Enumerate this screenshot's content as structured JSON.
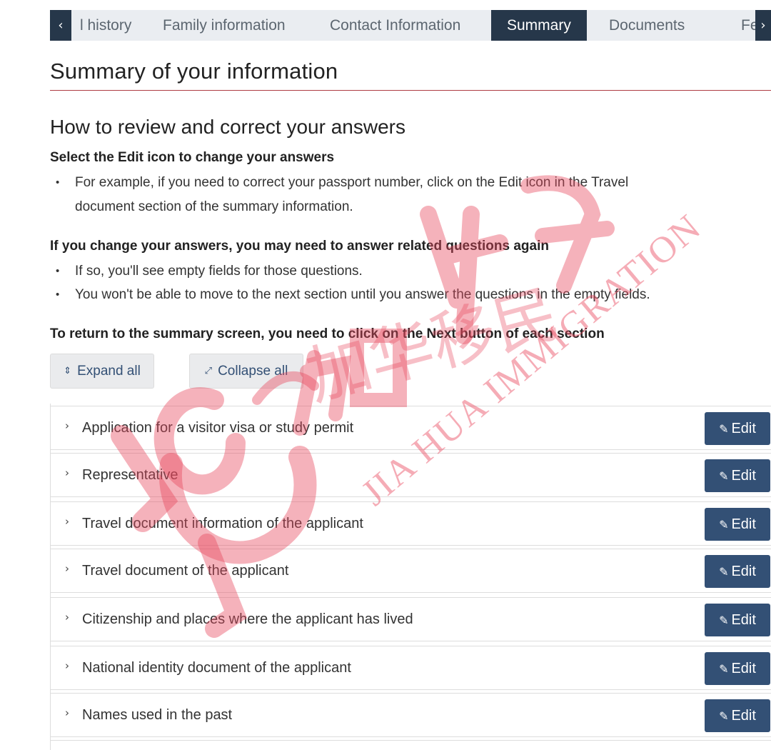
{
  "tabs": {
    "items": [
      {
        "label": "l history"
      },
      {
        "label": "Family information"
      },
      {
        "label": "Contact Information"
      },
      {
        "label": "Summary"
      },
      {
        "label": "Documents"
      },
      {
        "label": "Fe"
      }
    ],
    "prev_icon": "chevron-left-icon",
    "next_icon": "chevron-right-icon"
  },
  "page": {
    "title": "Summary of your information",
    "section_title": "How to review and correct your answers",
    "instructions": [
      {
        "heading": "Select the Edit icon to change your answers",
        "bullets": [
          {
            "line1": "For example, if you need to correct your passport number, click on the Edit icon in the Travel",
            "line2": "document section of the summary information."
          }
        ]
      },
      {
        "heading": "If you change your answers, you may need to answer related questions again",
        "bullets": [
          {
            "line1": "If so, you'll see empty fields for those questions."
          },
          {
            "line1": "You won't be able to move to the next section until you answer the questions in the empty fields."
          }
        ]
      },
      {
        "heading": "To return to the summary screen, you need to click on the Next button of each section"
      }
    ]
  },
  "controls": {
    "expand_all": "Expand all",
    "collapse_all": "Collapse all",
    "expand_icon": "expand-arrows-icon",
    "collapse_icon": "collapse-arrows-icon"
  },
  "sections": {
    "edit_label": "Edit",
    "edit_icon": "pencil-icon",
    "items": [
      {
        "label": "Application for a visitor visa or study permit"
      },
      {
        "label": "Representative"
      },
      {
        "label": "Travel document information of the applicant"
      },
      {
        "label": "Travel document of the applicant"
      },
      {
        "label": "Citizenship and places where the applicant has lived"
      },
      {
        "label": "National identity document of the applicant"
      },
      {
        "label": "Names used in the past"
      }
    ]
  },
  "watermark": {
    "text": "JIA HUA IMMIGRATION",
    "logo_text": "加华移民",
    "color": "#e8485e"
  },
  "colors": {
    "tab_active": "#26374a",
    "tab_bg": "#eaedf1",
    "edit_button": "#335075",
    "title_rule": "#af3c43"
  }
}
